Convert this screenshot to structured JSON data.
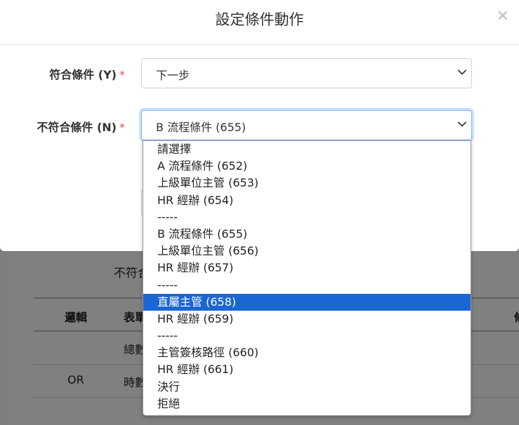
{
  "modal": {
    "title": "設定條件動作",
    "close_symbol": "×"
  },
  "form": {
    "match_label": "符合條件 (Y)",
    "nomatch_label": "不符合條件 (N)",
    "required_mark": "*",
    "match_value": "下一步",
    "nomatch_value": "B 流程條件 (655)"
  },
  "dropdown": {
    "options": [
      "請選擇",
      "A 流程條件 (652)",
      "上級單位主管 (653)",
      "HR 經辦 (654)",
      "-----",
      "B 流程條件 (655)",
      "上級單位主管 (656)",
      "HR 經辦 (657)",
      "-----",
      "直屬主管 (658)",
      "HR 經辦 (659)",
      "-----",
      "主管簽核路徑 (660)",
      "HR 經辦 (661)",
      "決行",
      "拒絕"
    ],
    "highlighted_index": 9
  },
  "background": {
    "label": "不符合",
    "table_headers": [
      "邏輯",
      "表單",
      "條"
    ],
    "rows": [
      [
        "",
        "總數"
      ],
      [
        "OR",
        "時數"
      ]
    ]
  },
  "colors": {
    "highlight": "#1a66d2",
    "required": "#d9534f",
    "focus": "#86b7fe"
  }
}
